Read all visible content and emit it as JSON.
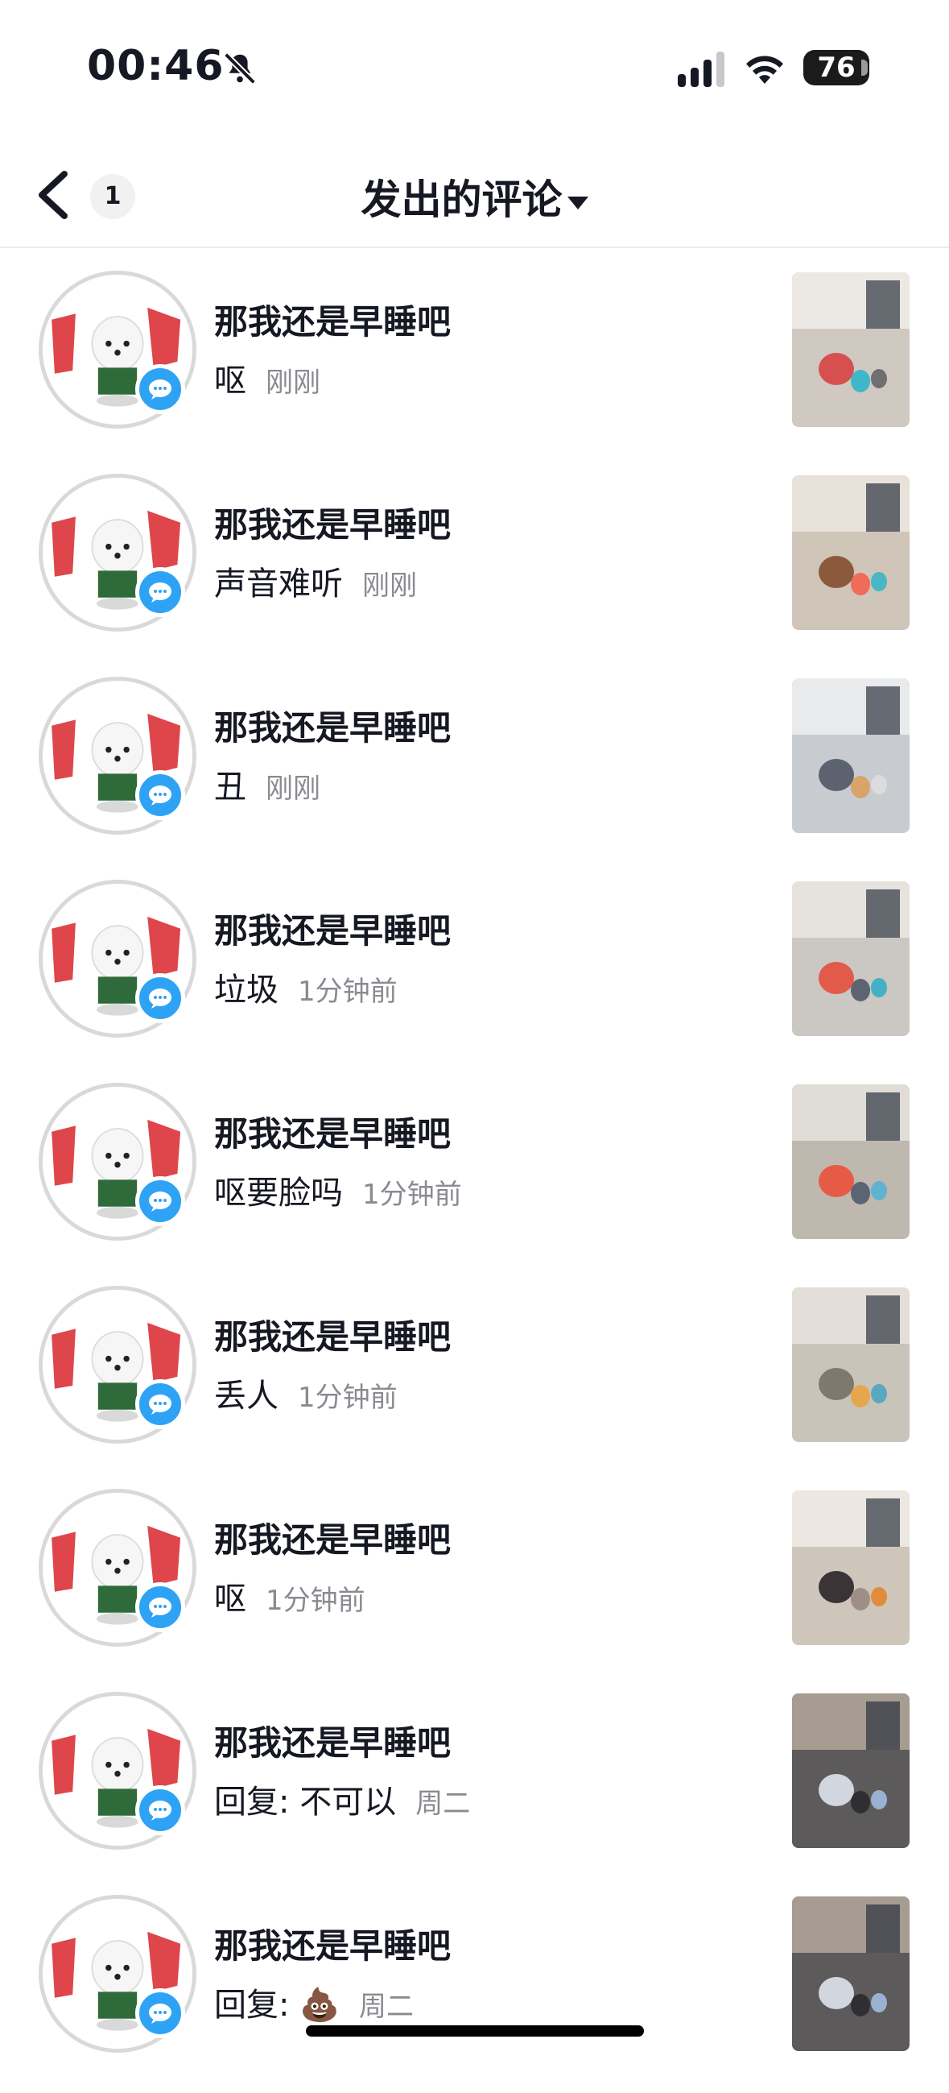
{
  "status_bar": {
    "time": "00:46",
    "battery": "76",
    "icons": [
      "bell-muted-icon",
      "cellular-signal-icon",
      "wifi-icon",
      "battery-icon"
    ]
  },
  "nav": {
    "back_icon": "chevron-left-icon",
    "badge_count": "1",
    "title": "发出的评论",
    "title_icon": "caret-down-icon"
  },
  "colors": {
    "accent_blue": "#2ea3f5",
    "text_primary": "#161823",
    "text_secondary": "#8a8b91"
  },
  "comments": [
    {
      "name": "那我还是早睡吧",
      "text": "呕",
      "time": "刚刚"
    },
    {
      "name": "那我还是早睡吧",
      "text": "声音难听",
      "time": "刚刚"
    },
    {
      "name": "那我还是早睡吧",
      "text": "丑",
      "time": "刚刚"
    },
    {
      "name": "那我还是早睡吧",
      "text": "垃圾",
      "time": "1分钟前"
    },
    {
      "name": "那我还是早睡吧",
      "text": "呕要脸吗",
      "time": "1分钟前"
    },
    {
      "name": "那我还是早睡吧",
      "text": "丢人",
      "time": "1分钟前"
    },
    {
      "name": "那我还是早睡吧",
      "text": "呕",
      "time": "1分钟前"
    },
    {
      "name": "那我还是早睡吧",
      "text": "回复: 不可以",
      "time": "周二"
    },
    {
      "name": "那我还是早睡吧",
      "text": "回复: 💩",
      "time": "周二"
    }
  ]
}
